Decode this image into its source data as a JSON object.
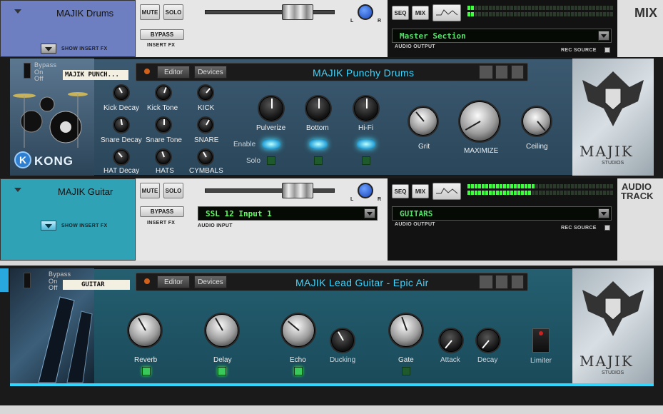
{
  "tracks": [
    {
      "name": "MAJIK Drums",
      "mute": "MUTE",
      "solo": "SOLO",
      "bypass": "BYPASS",
      "insert_fx": "INSERT FX",
      "show_insert_fx": "SHOW INSERT FX",
      "pan_l": "L",
      "pan_r": "R",
      "seq": "SEQ",
      "mix": "MIX",
      "output": "Master Section",
      "audio_output": "AUDIO OUTPUT",
      "rec_source": "REC SOURCE",
      "side_label": "MIX"
    },
    {
      "name": "MAJIK Guitar",
      "mute": "MUTE",
      "solo": "SOLO",
      "bypass": "BYPASS",
      "insert_fx": "INSERT FX",
      "show_insert_fx": "SHOW INSERT FX",
      "pan_l": "L",
      "pan_r": "R",
      "input": "SSL 12 Input 1",
      "audio_input": "AUDIO INPUT",
      "seq": "SEQ",
      "mix": "MIX",
      "output": "GUITARS",
      "audio_output": "AUDIO OUTPUT",
      "rec_source": "REC SOURCE",
      "side_label": "AUDIO TRACK"
    }
  ],
  "drums_device": {
    "bypass": "Bypass",
    "on": "On",
    "off": "Off",
    "tape": "MAJIK PUNCH...",
    "editor": "Editor",
    "devices": "Devices",
    "title": "MAJIK Punchy Drums",
    "kong_logo": "KONG",
    "knobs": [
      "Kick Decay",
      "Kick Tone",
      "KICK",
      "Snare Decay",
      "Snare Tone",
      "SNARE",
      "HAT Decay",
      "HATS",
      "CYMBALS"
    ],
    "fx_knobs": [
      "Pulverize",
      "Bottom",
      "Hi-Fi"
    ],
    "enable": "Enable",
    "solo": "Solo",
    "dyn_knobs": [
      "Grit",
      "MAXIMIZE",
      "Ceiling"
    ],
    "brand": "MAJIK",
    "brand_sub": "STUDIOS"
  },
  "guitar_device": {
    "bypass": "Bypass",
    "on": "On",
    "off": "Off",
    "tape": "GUITAR",
    "editor": "Editor",
    "devices": "Devices",
    "title": "MAJIK Lead Guitar - Epic Air",
    "knobs": [
      "Reverb",
      "Delay",
      "Echo",
      "Ducking",
      "Gate",
      "Attack",
      "Decay"
    ],
    "limiter": "Limiter",
    "brand": "MAJIK",
    "brand_sub": "STUDIOS"
  },
  "colors": {
    "drums_header": "#6e7fc2",
    "guitar_header": "#2fa3b8",
    "device_bg": "#2e4f63",
    "device_bg2": "#1f5f6e",
    "accent": "#3fd6ff",
    "meter": "#3dff3d"
  }
}
